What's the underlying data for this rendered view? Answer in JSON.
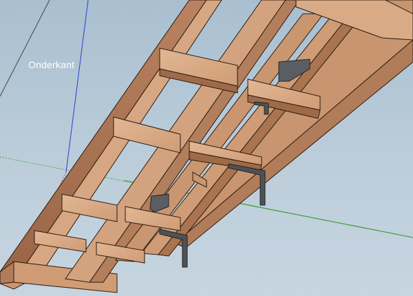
{
  "scene": {
    "label": "Onderkant"
  },
  "colors": {
    "background_top": "#a9bfd0",
    "background_bottom": "#c6d5e0",
    "wood_face_light": "#dcae8a",
    "wood_face_mid": "#c4916a",
    "wood_face_dark": "#9c6a48",
    "wood_edge": "#2a1a10",
    "bracket": "#5a5e62",
    "axis_blue": "#2a3ec8",
    "axis_green": "#4aa83a",
    "axis_red": "#c04a3a"
  }
}
